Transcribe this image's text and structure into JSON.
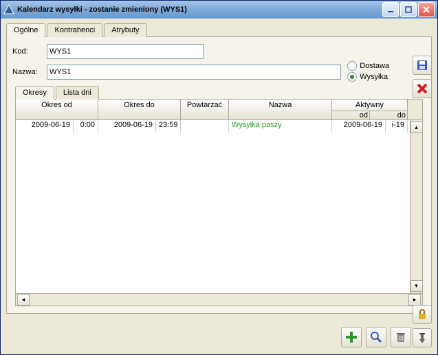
{
  "window": {
    "title": "Kalendarz wysyłki - zostanie zmieniony  (WYS1)"
  },
  "main_tabs": {
    "t0": "Ogólne",
    "t1": "Kontrahenci",
    "t2": "Atrybuty"
  },
  "form": {
    "kod_label": "Kod:",
    "kod_value": "WYS1",
    "nazwa_label": "Nazwa:",
    "nazwa_value": "WYS1"
  },
  "radios": {
    "r0": "Dostawa",
    "r1": "Wysyłka",
    "selected": "r1"
  },
  "sub_tabs": {
    "t0": "Okresy",
    "t1": "Lista dni"
  },
  "grid": {
    "headers": {
      "c1": "Okres od",
      "c2": "Okres do",
      "c3": "Powtarzać",
      "c4": "Nazwa",
      "c5": "Aktywny",
      "c5a": "od",
      "c5b": "do"
    },
    "row0": {
      "od_date": "2009-06-19",
      "od_time": "0:00",
      "do_date": "2009-06-19",
      "do_time": "23:59",
      "powt": "",
      "nazwa": "Wysyłka paszy",
      "akt_od": "2009-06-19",
      "akt_do": "i-19"
    }
  },
  "icons": {
    "save": "save-icon",
    "close": "close-icon",
    "add": "plus-icon",
    "zoom": "magnifier-icon",
    "trash": "trash-icon",
    "lock": "lock-icon",
    "pin": "pin-icon"
  }
}
